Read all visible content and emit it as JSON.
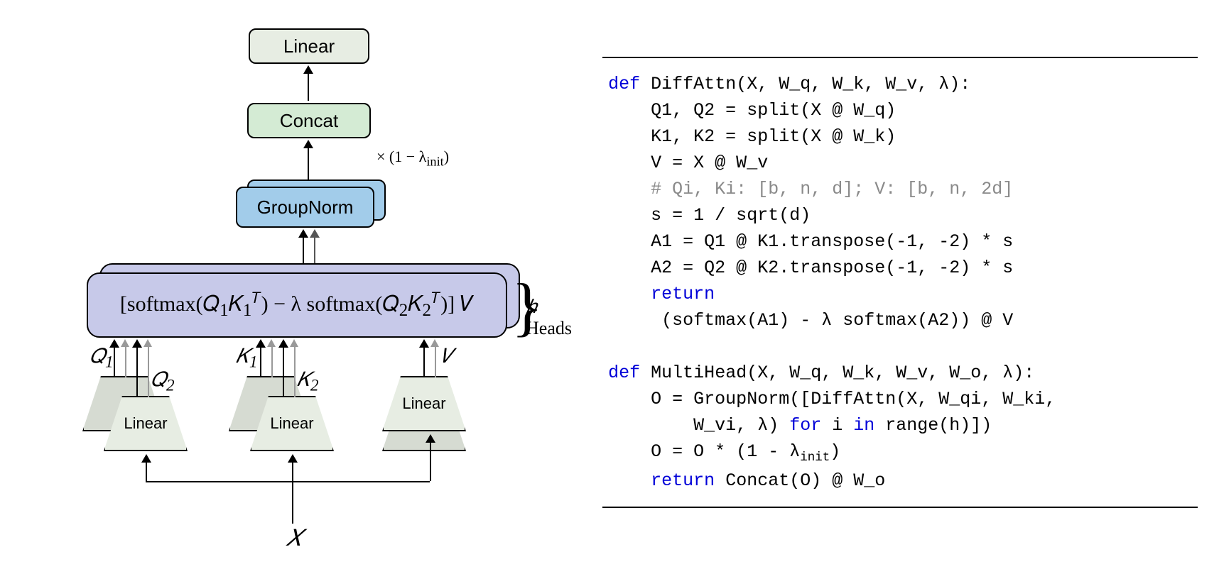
{
  "diagram": {
    "linear_top": "Linear",
    "concat": "Concat",
    "scale_anno": "× (1 − λ",
    "scale_anno_sub": "init",
    "scale_anno_close": ")",
    "groupnorm": "GroupNorm",
    "softmax_open": "[softmax(",
    "softmax_q1": "𝑄",
    "softmax_q1sub": "1",
    "softmax_k1": "𝐾",
    "softmax_k1sub": "1",
    "softmax_t": "𝑇",
    "softmax_minus": ") − λ softmax(",
    "softmax_q2": "𝑄",
    "softmax_q2sub": "2",
    "softmax_k2": "𝐾",
    "softmax_k2sub": "2",
    "softmax_close": ")] 𝑉",
    "heads_h": "ℎ",
    "heads_word": " Heads",
    "proj_label": "Linear",
    "Q1": "𝑄",
    "Q1s": "1",
    "Q2": "𝑄",
    "Q2s": "2",
    "K1": "𝐾",
    "K1s": "1",
    "K2": "𝐾",
    "K2s": "2",
    "V": "𝑉",
    "X": "𝑋"
  },
  "code": {
    "l1a": "def",
    "l1b": " DiffAttn(X, W_q, W_k, W_v, λ):",
    "l2": "    Q1, Q2 = split(X @ W_q)",
    "l3": "    K1, K2 = split(X @ W_k)",
    "l4": "    V = X @ W_v",
    "l5": "    # Qi, Ki: [b, n, d]; V: [b, n, 2d]",
    "l6": "    s = 1 / sqrt(d)",
    "l7": "    A1 = Q1 @ K1.transpose(-1, -2) * s",
    "l8": "    A2 = Q2 @ K2.transpose(-1, -2) * s",
    "l9a": "    return",
    "l10": "     (softmax(A1) - λ softmax(A2)) @ V",
    "blk": " ",
    "l12a": "def",
    "l12b": " MultiHead(X, W_q, W_k, W_v, W_o, λ):",
    "l13": "    O = GroupNorm([DiffAttn(X, W_qi, W_ki,",
    "l14a": "        W_vi, λ) ",
    "l14b": "for",
    "l14c": " i ",
    "l14d": "in",
    "l14e": " range(h)])",
    "l15a": "    O = O * (1 - λ",
    "l15sub": "init",
    "l15b": ")",
    "l16a": "    return",
    "l16b": " Concat(O) @ W_o"
  }
}
